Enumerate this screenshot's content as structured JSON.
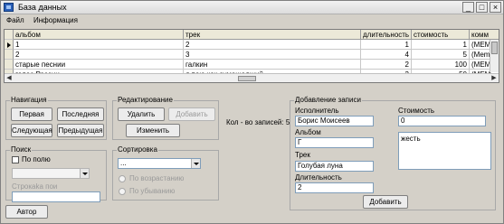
{
  "window": {
    "title": "База данных"
  },
  "menu": [
    "Файл",
    "Информация"
  ],
  "grid": {
    "columns": [
      "альбом",
      "трек",
      "длительность",
      "стоимость",
      "комм"
    ],
    "rows": [
      {
        "album": "1",
        "track": "2",
        "duration": "1",
        "cost": "1",
        "comment": "(MEM"
      },
      {
        "album": "2",
        "track": "3",
        "duration": "4",
        "cost": "5",
        "comment": "(Mem"
      },
      {
        "album": "старые песнии",
        "track": "галкин",
        "duration": "2",
        "cost": "100",
        "comment": "(MEM"
      },
      {
        "album": "голос России",
        "track": "я пою как сумашедший",
        "duration": "3",
        "cost": "50",
        "comment": "(MEM"
      }
    ]
  },
  "navigation": {
    "title": "Навигация",
    "first": "Первая",
    "last": "Последняя",
    "next": "Следующая",
    "prev": "Предыдущая"
  },
  "editing": {
    "title": "Редактирование",
    "delete": "Удалить",
    "add": "Добавить",
    "edit": "Изменить"
  },
  "record_count": "Кол - во записей: 5",
  "search": {
    "title": "Поиск",
    "by_field": "По полю",
    "combo_value": "",
    "string_label": "Строкаka пои",
    "input_value": ""
  },
  "sorting": {
    "title": "Сортировка",
    "combo_value": "...",
    "ascending": "По возрастанию",
    "descending": "По убыванию"
  },
  "author_button": "Автор",
  "add_record": {
    "title": "Добавление записи",
    "performer_label": "Исполнитель",
    "performer_value": "Борис Моисеев",
    "album_label": "Альбом",
    "album_value": "Г",
    "track_label": "Трек",
    "track_value": "Голубая луна",
    "duration_label": "Длительность",
    "duration_value": "2",
    "cost_label": "Стоимость",
    "cost_value": "0",
    "comment_value": "жесть",
    "add_button": "Добавить"
  }
}
